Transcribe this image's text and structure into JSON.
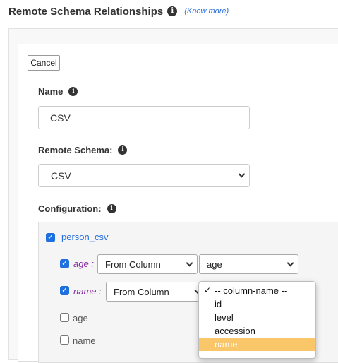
{
  "header": {
    "title": "Remote Schema Relationships",
    "know_more": "(Know more)"
  },
  "form": {
    "cancel_label": "Cancel",
    "name_label": "Name",
    "name_value": "CSV",
    "remote_schema_label": "Remote Schema:",
    "remote_schema_value": "CSV",
    "configuration_label": "Configuration:"
  },
  "config": {
    "root_field": "person_csv",
    "root_checked": true,
    "args": [
      {
        "name": "age",
        "checked": true,
        "source": "From Column",
        "column": "age"
      },
      {
        "name": "name",
        "checked": true,
        "source": "From Column",
        "column": "-- column-name --"
      }
    ],
    "colon": ":",
    "fields": [
      {
        "label": "age",
        "checked": false
      },
      {
        "label": "name",
        "checked": false
      }
    ]
  },
  "dropdown": {
    "options": [
      "-- column-name --",
      "id",
      "level",
      "accession",
      "name"
    ],
    "checked_option": "-- column-name --",
    "highlighted_option": "name",
    "highlight_color": "#f9c76a"
  },
  "colors": {
    "accent": "#1e6fe0",
    "link": "#2a6fdb",
    "arg": "#8a2aa8"
  }
}
